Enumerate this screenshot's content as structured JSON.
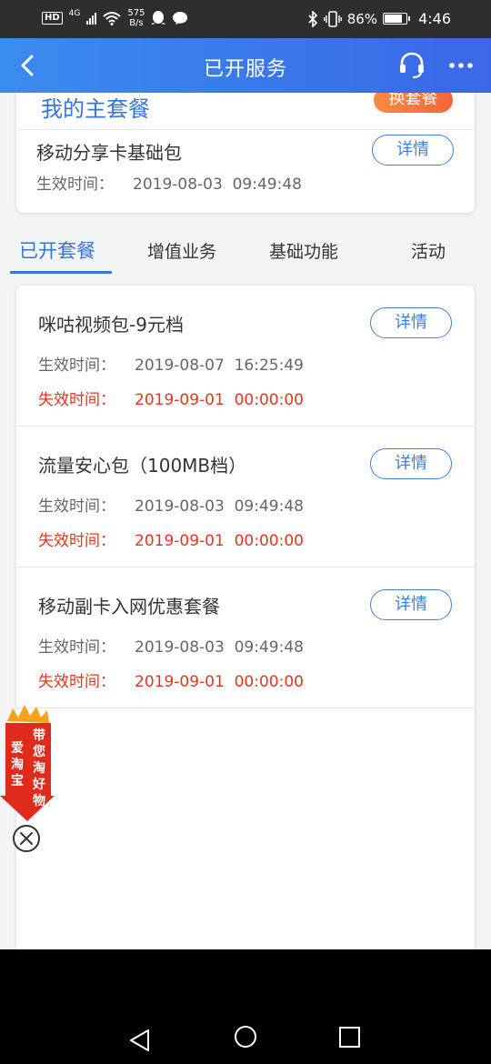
{
  "status_bar": {
    "network_badge": "HD",
    "network_type": "4G",
    "speed_value": "575",
    "speed_unit": "B/s",
    "battery_percent": "86%",
    "battery_level": 0.86,
    "time": "4:46"
  },
  "header": {
    "title": "已开服务",
    "back_icon": "chevron-left-icon",
    "service_icon": "headset-icon",
    "more_icon": "more-dots-icon"
  },
  "main_package": {
    "title": "我的主套餐",
    "switch_label": "换套餐",
    "name": "移动分享卡基础包",
    "detail_label": "详情",
    "effective_label": "生效时间：",
    "effective_time": "2019-08-03  09:49:48"
  },
  "tabs": [
    {
      "label": "已开套餐",
      "active": true
    },
    {
      "label": "增值业务",
      "active": false
    },
    {
      "label": "基础功能",
      "active": false
    },
    {
      "label": "活动",
      "active": false
    }
  ],
  "packages": [
    {
      "name": "咪咕视频包-9元档",
      "detail_label": "详情",
      "effective_label": "生效时间：",
      "effective_time": "2019-08-07  16:25:49",
      "expire_label": "失效时间：",
      "expire_time": "2019-09-01  00:00:00"
    },
    {
      "name": "流量安心包（100MB档）",
      "detail_label": "详情",
      "effective_label": "生效时间：",
      "effective_time": "2019-08-03  09:49:48",
      "expire_label": "失效时间：",
      "expire_time": "2019-09-01  00:00:00"
    },
    {
      "name": "移动副卡入网优惠套餐",
      "detail_label": "详情",
      "effective_label": "生效时间：",
      "effective_time": "2019-08-03  09:49:48",
      "expire_label": "失效时间：",
      "expire_time": "2019-09-01  00:00:00"
    }
  ],
  "floating_ad": {
    "line1": "带您淘好物",
    "line2": "爱淘宝",
    "close_icon": "close-circle-icon"
  },
  "nav": {
    "back_icon": "triangle-back-icon",
    "home_icon": "circle-home-icon",
    "recents_icon": "square-recents-icon"
  },
  "colors": {
    "accent": "#3377dd",
    "expire_red": "#e8341c",
    "switch_orange": "#f3653a",
    "ad_red": "#e02a1c"
  }
}
